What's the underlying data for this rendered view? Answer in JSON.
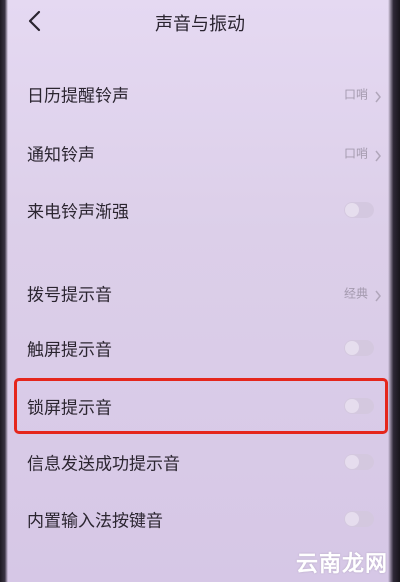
{
  "header": {
    "title": "声音与振动"
  },
  "settings": {
    "items": [
      {
        "label": "日历提醒铃声",
        "value": "口哨",
        "control": "chevron"
      },
      {
        "label": "通知铃声",
        "value": "口哨",
        "control": "chevron"
      },
      {
        "label": "来电铃声渐强",
        "control": "toggle",
        "on": false
      },
      {
        "label": "拨号提示音",
        "value": "经典",
        "control": "chevron"
      },
      {
        "label": "触屏提示音",
        "control": "toggle",
        "on": false
      },
      {
        "label": "锁屏提示音",
        "control": "toggle",
        "on": false,
        "highlighted": true
      },
      {
        "label": "信息发送成功提示音",
        "control": "toggle",
        "on": false
      },
      {
        "label": "内置输入法按键音",
        "control": "toggle",
        "on": false
      }
    ]
  },
  "highlight": {
    "color": "#e5261c",
    "target": "锁屏提示音"
  },
  "watermark": {
    "text": "云南龙网"
  },
  "colors": {
    "background": "#dccfe9",
    "text": "#2b2530",
    "secondary_text": "#a49aae",
    "toggle_off": "#d4c8df"
  }
}
